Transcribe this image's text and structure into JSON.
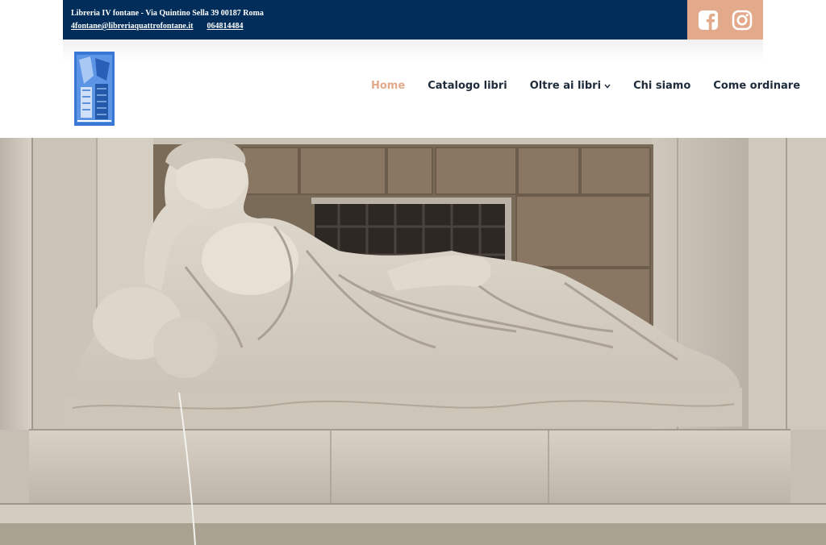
{
  "topbar": {
    "address": "Libreria IV fontane - Via Quintino Sella 39 00187 Roma",
    "email": "4fontane@libreriaquattrofontane.it",
    "phone": "064814484"
  },
  "social": {
    "icons": [
      "facebook-icon",
      "instagram-icon"
    ]
  },
  "nav": {
    "items": [
      {
        "label": "Home"
      },
      {
        "label": "Catalogo libri"
      },
      {
        "label": "Oltre ai libri"
      },
      {
        "label": "Chi siamo"
      },
      {
        "label": "Come ordinare"
      }
    ],
    "active_index": 0,
    "dropdown_icon": "chevron-down-icon"
  },
  "colors": {
    "topbar": "#002d5a",
    "accent": "#e2a98b",
    "nav_text": "#1d2b3a"
  },
  "hero": {
    "image": "reclining-marble-statue-fountain"
  }
}
